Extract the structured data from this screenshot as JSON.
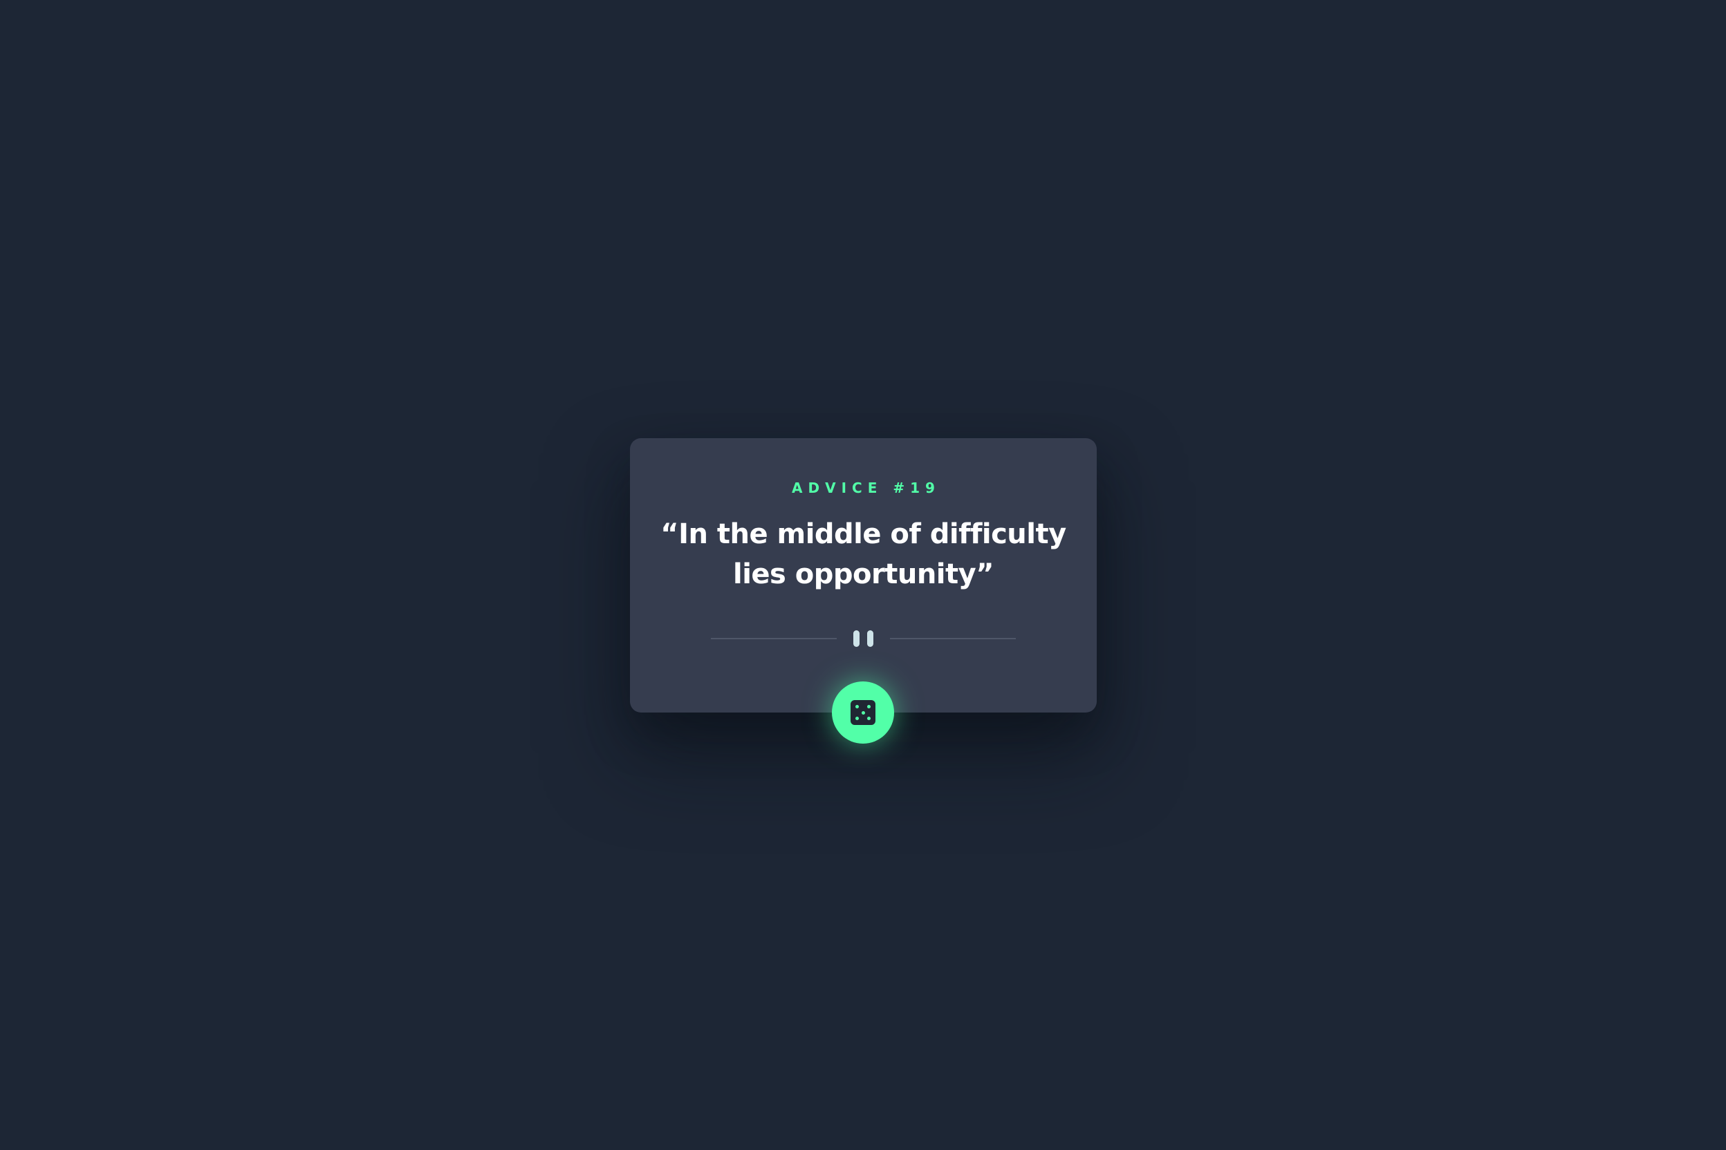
{
  "card": {
    "advice_label": "ADVICE #19",
    "quote": "“In the middle of difficulty lies opportunity”"
  },
  "divider": {
    "icon": "pause-icon"
  },
  "generate_button": {
    "icon": "dice-icon"
  },
  "colors": {
    "background": "#1d2635",
    "card": "#363d4f",
    "accent": "#52ffa8",
    "text": "#ffffff",
    "divider": "#4f5769",
    "pause": "#cee3e9"
  }
}
